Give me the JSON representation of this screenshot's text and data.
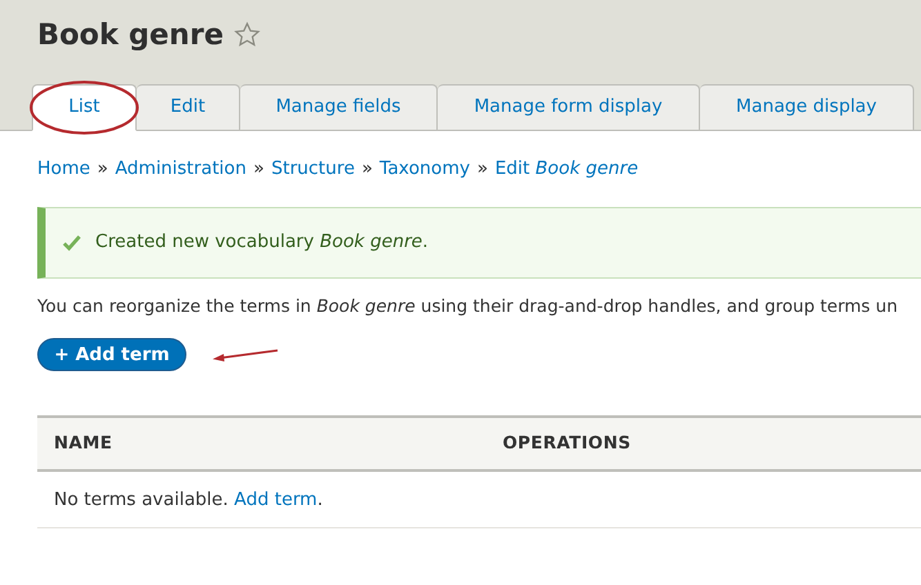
{
  "page_title": "Book genre",
  "tabs": [
    {
      "label": "List",
      "selected": true
    },
    {
      "label": "Edit",
      "selected": false
    },
    {
      "label": "Manage fields",
      "selected": false
    },
    {
      "label": "Manage form display",
      "selected": false
    },
    {
      "label": "Manage display",
      "selected": false
    }
  ],
  "breadcrumb": [
    "Home",
    "Administration",
    "Structure",
    "Taxonomy",
    "Edit *Book genre*"
  ],
  "breadcrumb_separator": "»",
  "status_message": "Created new vocabulary *Book genre*.",
  "help_text": "You can reorganize the terms in *Book genre* using their drag-and-drop handles, and group terms un",
  "add_button": "+ Add term",
  "table": {
    "columns": [
      "NAME",
      "OPERATIONS"
    ],
    "empty_text": "No terms available.",
    "empty_link": "Add term",
    "empty_suffix": "."
  }
}
